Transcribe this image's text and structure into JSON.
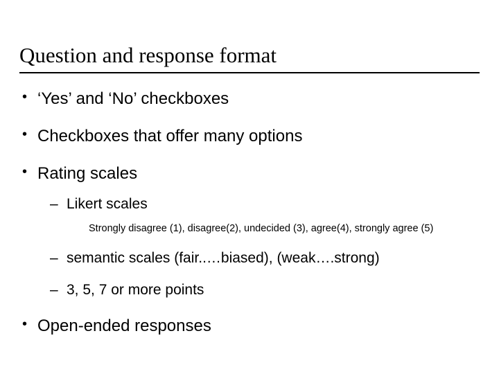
{
  "title": "Question and response format",
  "bullets": {
    "b1": "‘Yes’ and ‘No’ checkboxes",
    "b2": "Checkboxes that offer many options",
    "b3": "Rating scales",
    "b3_sub": {
      "s1": "Likert scales",
      "s1_detail": "Strongly disagree (1), disagree(2), undecided (3), agree(4), strongly agree (5)",
      "s2": "semantic scales (fair..…biased), (weak….strong)",
      "s3": "3, 5, 7 or more points"
    },
    "b4": "Open-ended responses"
  }
}
